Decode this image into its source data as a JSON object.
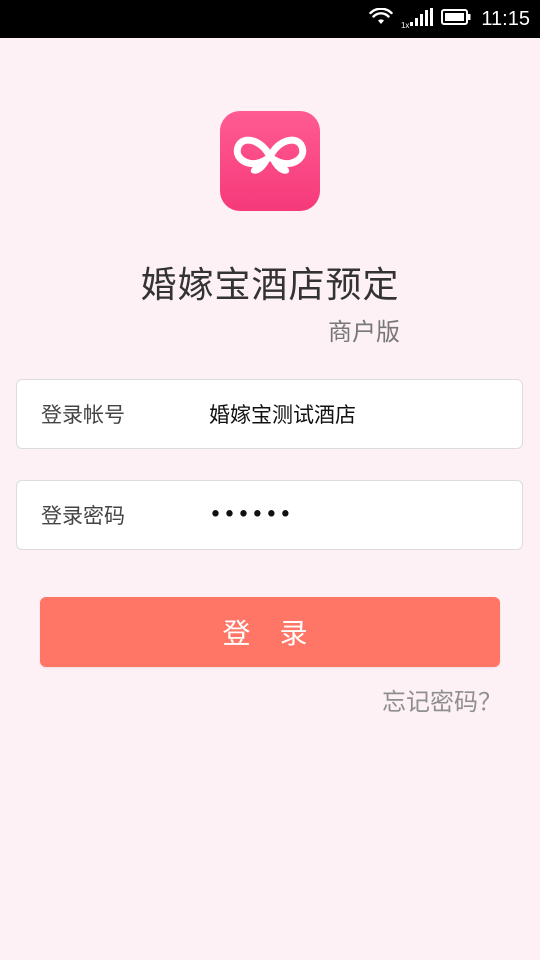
{
  "status_bar": {
    "time": "11:15",
    "network_label": "1x",
    "icons": [
      "wifi-icon",
      "signal-icon",
      "battery-icon"
    ]
  },
  "app": {
    "title": "婚嫁宝酒店预定",
    "subtitle": "商户版",
    "logo_icon": "butterfly-logo-icon"
  },
  "login": {
    "account_label": "登录帐号",
    "account_value": "婚嫁宝测试酒店",
    "password_label": "登录密码",
    "password_value": "••••••",
    "button_label": "登 录",
    "forgot_label": "忘记密码？"
  },
  "colors": {
    "background": "#fdf1f6",
    "brand_pink": "#f6397a",
    "button_coral": "#ff7666"
  }
}
